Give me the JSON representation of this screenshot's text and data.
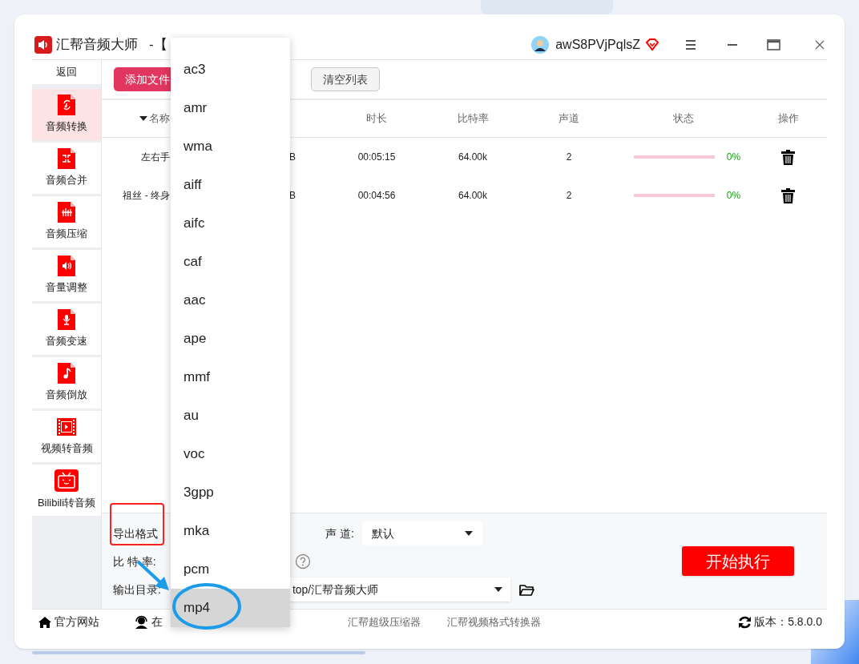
{
  "window": {
    "app_name": "汇帮音频大师",
    "title_suffix": "-【",
    "user": "awS8PVjPqlsZ"
  },
  "sidebar": {
    "back": "返回",
    "items": [
      {
        "label": "音频转换",
        "kind": "convert",
        "selected": true
      },
      {
        "label": "音频合并",
        "kind": "merge",
        "selected": false
      },
      {
        "label": "音频压缩",
        "kind": "compress",
        "selected": false
      },
      {
        "label": "音量调整",
        "kind": "volume",
        "selected": false
      },
      {
        "label": "音频变速",
        "kind": "speed",
        "selected": false
      },
      {
        "label": "音频倒放",
        "kind": "reverse",
        "selected": false
      },
      {
        "label": "视频转音频",
        "kind": "video",
        "selected": false
      },
      {
        "label": "Bilibili转音频",
        "kind": "bilibili",
        "selected": false
      }
    ]
  },
  "toolbar": {
    "buttons": [
      {
        "label": "添加文件",
        "kind": "primary"
      },
      {
        "label": "清空列表",
        "kind": "secondary"
      }
    ]
  },
  "table": {
    "columns": [
      "名称",
      "时长",
      "比特率",
      "声道",
      "状态",
      "操作"
    ],
    "rows": [
      {
        "name": "左右手",
        "size": "B",
        "duration": "00:05:15",
        "bitrate": "64.00k",
        "channels": "2",
        "level": 0,
        "progress": "0%"
      },
      {
        "name": "祖丝 - 终身",
        "size": "B",
        "duration": "00:04:56",
        "bitrate": "64.00k",
        "channels": "2",
        "level": 0,
        "progress": "0%"
      }
    ]
  },
  "settings": {
    "format_label": "导出格式",
    "bitrate_label": "比 特 率:",
    "output_label": "输出目录:",
    "output_path": "top/汇帮音频大师",
    "channel_label": "声 道:",
    "channel_value": "默认",
    "start_button": "开始执行"
  },
  "format_menu": {
    "items": [
      {
        "label": "ac3",
        "selected": false
      },
      {
        "label": "amr",
        "selected": false
      },
      {
        "label": "wma",
        "selected": false
      },
      {
        "label": "aiff",
        "selected": false
      },
      {
        "label": "aifc",
        "selected": false
      },
      {
        "label": "caf",
        "selected": false
      },
      {
        "label": "aac",
        "selected": false
      },
      {
        "label": "ape",
        "selected": false
      },
      {
        "label": "mmf",
        "selected": false
      },
      {
        "label": "au",
        "selected": false
      },
      {
        "label": "voc",
        "selected": false
      },
      {
        "label": "3gpp",
        "selected": false
      },
      {
        "label": "mka",
        "selected": false
      },
      {
        "label": "pcm",
        "selected": false
      },
      {
        "label": "mp4",
        "selected": true
      }
    ]
  },
  "footer": {
    "links": [
      {
        "label": "官方网站",
        "kind": "home"
      },
      {
        "label": "在",
        "kind": "support"
      },
      {
        "label": "汇帮超级压缩器",
        "kind": "plain"
      },
      {
        "label": "汇帮视频格式转换器",
        "kind": "plain"
      }
    ],
    "version": "版本：5.8.0.0"
  }
}
